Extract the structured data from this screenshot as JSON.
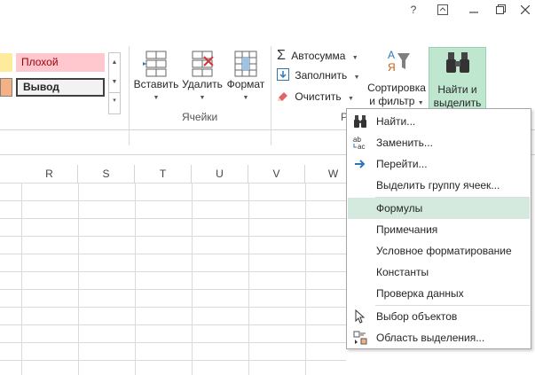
{
  "titlebar": {
    "help": "?",
    "restore_ribbon": "⊼",
    "minimize": "—",
    "restore": "❐",
    "close": "✕"
  },
  "account": {
    "warning": "⚠",
    "caret": "▾"
  },
  "styles": {
    "bad": "Плохой",
    "output": "Вывод",
    "bad_bg": "#ffc7ce",
    "bad_fg": "#9c0006",
    "neutral_bg": "#ffeb9c",
    "calc_bg": "#f2f2f2"
  },
  "cells_group": {
    "label": "Ячейки",
    "insert": "Вставить",
    "delete": "Удалить",
    "format": "Формат"
  },
  "editing_group": {
    "label": "Р",
    "autosum": "Автосумма",
    "fill": "Заполнить",
    "clear": "Очистить",
    "sort_line1": "Сортировка",
    "sort_line2": "и фильтр",
    "find_line1": "Найти и",
    "find_line2": "выделить",
    "accent": "#bfe6cf"
  },
  "columns": [
    "R",
    "S",
    "T",
    "U",
    "V",
    "W"
  ],
  "menu": {
    "items": [
      {
        "label": "Найти...",
        "icon": "binoculars-icon"
      },
      {
        "label": "Заменить...",
        "icon": "replace-icon"
      },
      {
        "label": "Перейти...",
        "icon": "arrow-right-icon"
      },
      {
        "label": "Выделить группу ячеек...",
        "icon": ""
      },
      {
        "label": "Формулы",
        "icon": "",
        "highlighted": true
      },
      {
        "label": "Примечания",
        "icon": ""
      },
      {
        "label": "Условное форматирование",
        "icon": ""
      },
      {
        "label": "Константы",
        "icon": ""
      },
      {
        "label": "Проверка данных",
        "icon": ""
      },
      {
        "label": "Выбор объектов",
        "icon": "cursor-icon"
      },
      {
        "label": "Область выделения...",
        "icon": "selection-pane-icon"
      }
    ]
  }
}
